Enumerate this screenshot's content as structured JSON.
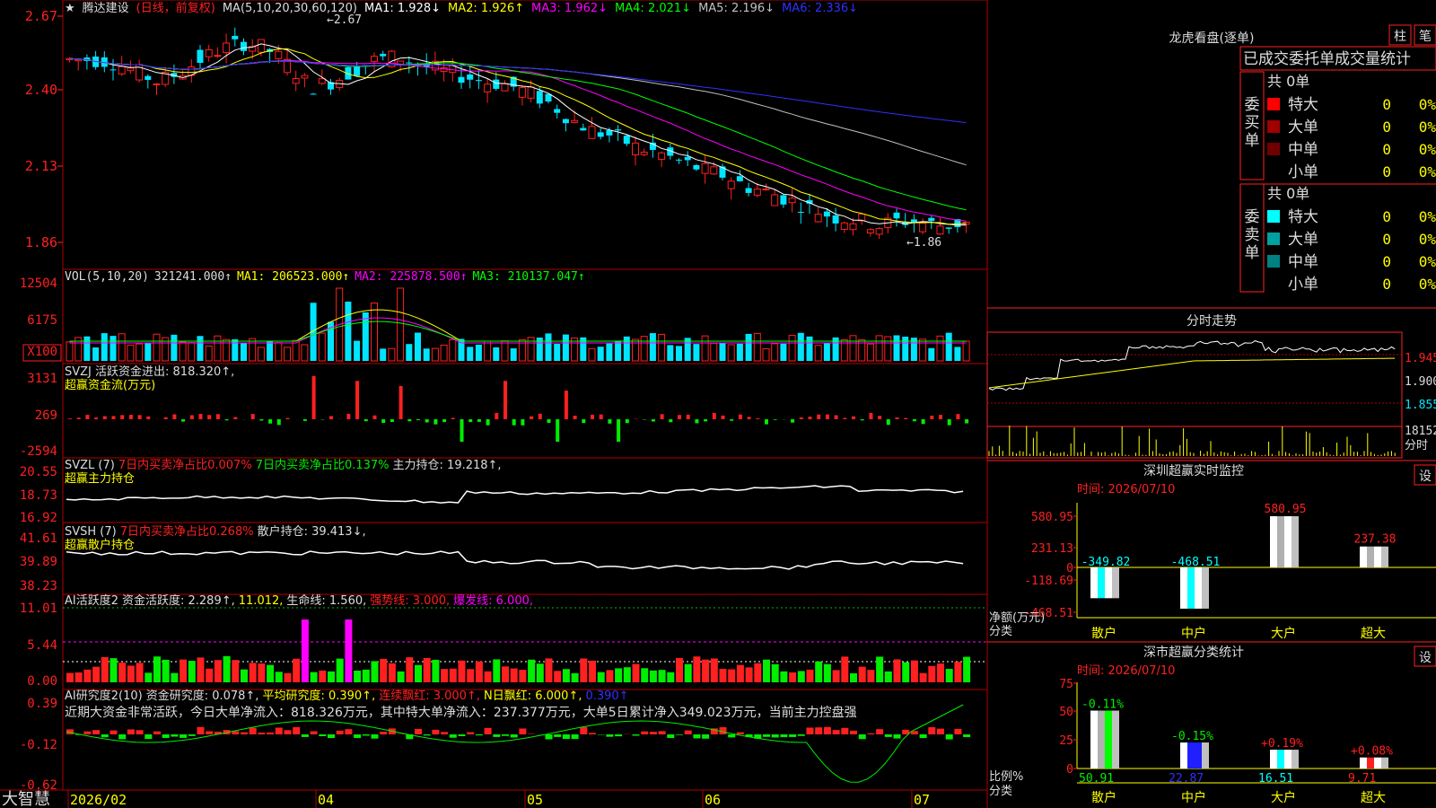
{
  "app": {
    "brand": "大智慧"
  },
  "colors": {
    "up": "#ff2020",
    "down": "#00e5ff",
    "green": "#00ee00",
    "grid": "#b00000",
    "magenta": "#ff00ff",
    "yellow": "#ffff00"
  },
  "kline": {
    "header": {
      "star": "★",
      "name": "腾达建设",
      "mode": "(日线，前复权)",
      "ma_def": "MA(5,10,20,30,60,120)",
      "ma1": "MA1: 1.928↓",
      "ma2": "MA2: 1.926↑",
      "ma3": "MA3: 1.962↓",
      "ma4": "MA4: 2.021↓",
      "ma5": "MA5: 2.196↓",
      "ma6": "MA6: 2.336↓"
    },
    "y_labels": [
      "2.67",
      "2.40",
      "2.13",
      "1.86"
    ],
    "high_label": "2.67",
    "low_label": "1.86",
    "x_labels": [
      "2026/02",
      "04",
      "05",
      "06",
      "07"
    ]
  },
  "vol": {
    "header": {
      "def": "VOL(5,10,20)",
      "val": "321241.000↑",
      "ma1": "MA1: 206523.000↑",
      "ma2": "MA2: 225878.500↑",
      "ma3": "MA3: 210137.047↑"
    },
    "y_labels": [
      "12504",
      "6175",
      "X100"
    ]
  },
  "svzj": {
    "header": {
      "def": "SVZJ",
      "label": "活跃资金进出: 818.320↑,"
    },
    "sub": "超赢资金流(万元)",
    "y_labels": [
      "3131",
      "269",
      "-2594"
    ]
  },
  "svzl": {
    "header": {
      "def": "SVZL (7)",
      "a": "7日内买卖净占比0.007%",
      "b": "7日内买卖净占比0.137%",
      "c": "主力持仓: 19.218↑,"
    },
    "sub": "超赢主力持仓",
    "y_labels": [
      "20.55",
      "18.73",
      "16.92"
    ]
  },
  "svsh": {
    "header": {
      "def": "SVSH (7)",
      "a": "7日内买卖净占比0.268%",
      "b": "散户持仓: 39.413↓,"
    },
    "sub": "超赢散户持仓",
    "y_labels": [
      "41.61",
      "39.89",
      "38.23"
    ]
  },
  "ai1": {
    "header": {
      "def": "AI活跃度2",
      "a": "资金活跃度: 2.289↑,",
      "b": "11.012,",
      "c": "生命线: 1.560,",
      "d": "强势线: 3.000,",
      "e": "爆发线: 6.000,"
    },
    "y_labels": [
      "11.01",
      "5.44",
      "0.00"
    ]
  },
  "ai2": {
    "header": {
      "def": "AI研究度2(10)",
      "a": "资金研究度: 0.078↑,",
      "b": "平均研究度: 0.390↑,",
      "c": "连续飘红: 3.000↑,",
      "d": "N日飘红: 6.000↑,",
      "e": "0.390↑"
    },
    "comment": "近期大资金非常活跃，今日大单净流入：818.326万元，其中特大单净流入：237.377万元，大单5日累计净入349.023万元，当前主力控盘强",
    "y_labels": [
      "0.39",
      "-0.12",
      "-0.62"
    ]
  },
  "right": {
    "lhb": {
      "title": "龙虎看盘(逐单)",
      "btn1": "柱",
      "btn2": "笔",
      "header": "已成交委托单成交量统计",
      "buy": {
        "side": "委买单",
        "total": "共 0单",
        "rows": [
          {
            "label": "特大",
            "n": "0",
            "p": "0%",
            "color": "#ff0000"
          },
          {
            "label": "大单",
            "n": "0",
            "p": "0%",
            "color": "#a00000"
          },
          {
            "label": "中单",
            "n": "0",
            "p": "0%",
            "color": "#700000"
          },
          {
            "label": "小单",
            "n": "0",
            "p": "0%",
            "color": ""
          }
        ]
      },
      "sell": {
        "side": "委卖单",
        "total": "共 0单",
        "rows": [
          {
            "label": "特大",
            "n": "0",
            "p": "0%",
            "color": "#00ffff"
          },
          {
            "label": "大单",
            "n": "0",
            "p": "0%",
            "color": "#00a0a0"
          },
          {
            "label": "中单",
            "n": "0",
            "p": "0%",
            "color": "#008080"
          },
          {
            "label": "小单",
            "n": "0",
            "p": "0%",
            "color": ""
          }
        ]
      }
    },
    "fs": {
      "title": "分时走势",
      "y_labels": [
        "1.945",
        "1.900",
        "1.855"
      ],
      "vol_label": "18152",
      "vol_sub": "分时"
    },
    "monitor": {
      "title": "深圳超赢实时监控",
      "btn": "设",
      "time": "时间: 2026/07/10",
      "y_labels": [
        "580.95",
        "231.13",
        "0",
        "-118.69",
        "-468.51"
      ],
      "ylabel": "净额(万元)",
      "xlabel": "分类",
      "bars": [
        {
          "label": "散户",
          "value": -349.82,
          "text": "-349.82"
        },
        {
          "label": "中户",
          "value": -468.51,
          "text": "-468.51"
        },
        {
          "label": "大户",
          "value": 580.95,
          "text": "580.95"
        },
        {
          "label": "超大",
          "value": 237.38,
          "text": "237.38"
        }
      ]
    },
    "stat": {
      "title": "深市超赢分类统计",
      "btn": "设",
      "time": "时间: 2026/07/10",
      "y_labels": [
        "75",
        "50",
        "25",
        "0"
      ],
      "ylabel": "比例%",
      "xlabel": "分类",
      "bars": [
        {
          "label": "散户",
          "value": 50.91,
          "text": "50.91",
          "chg": "-0.11%"
        },
        {
          "label": "中户",
          "value": 22.87,
          "text": "22.87",
          "chg": "-0.15%"
        },
        {
          "label": "大户",
          "value": 16.51,
          "text": "16.51",
          "chg": "+0.19%"
        },
        {
          "label": "超大",
          "value": 9.71,
          "text": "9.71",
          "chg": "+0.08%"
        }
      ]
    }
  },
  "chart_data": {
    "type": "candlestick",
    "title": "腾达建设 (日线，前复权)",
    "ylim": [
      1.8,
      2.7
    ],
    "x": [
      "2026/02",
      "04",
      "05",
      "06",
      "07"
    ],
    "close_approx": [
      2.52,
      2.52,
      2.51,
      2.48,
      2.44,
      2.47,
      2.52,
      2.56,
      2.58,
      2.56,
      2.5,
      2.42,
      2.44,
      2.48,
      2.52,
      2.53,
      2.5,
      2.48,
      2.46,
      2.44,
      2.43,
      2.4,
      2.36,
      2.3,
      2.26,
      2.24,
      2.2,
      2.18,
      2.15,
      2.12,
      2.1,
      2.06,
      2.04,
      2.01,
      1.98,
      1.95,
      1.94,
      1.92,
      1.94,
      1.93,
      1.92,
      1.93
    ]
  }
}
